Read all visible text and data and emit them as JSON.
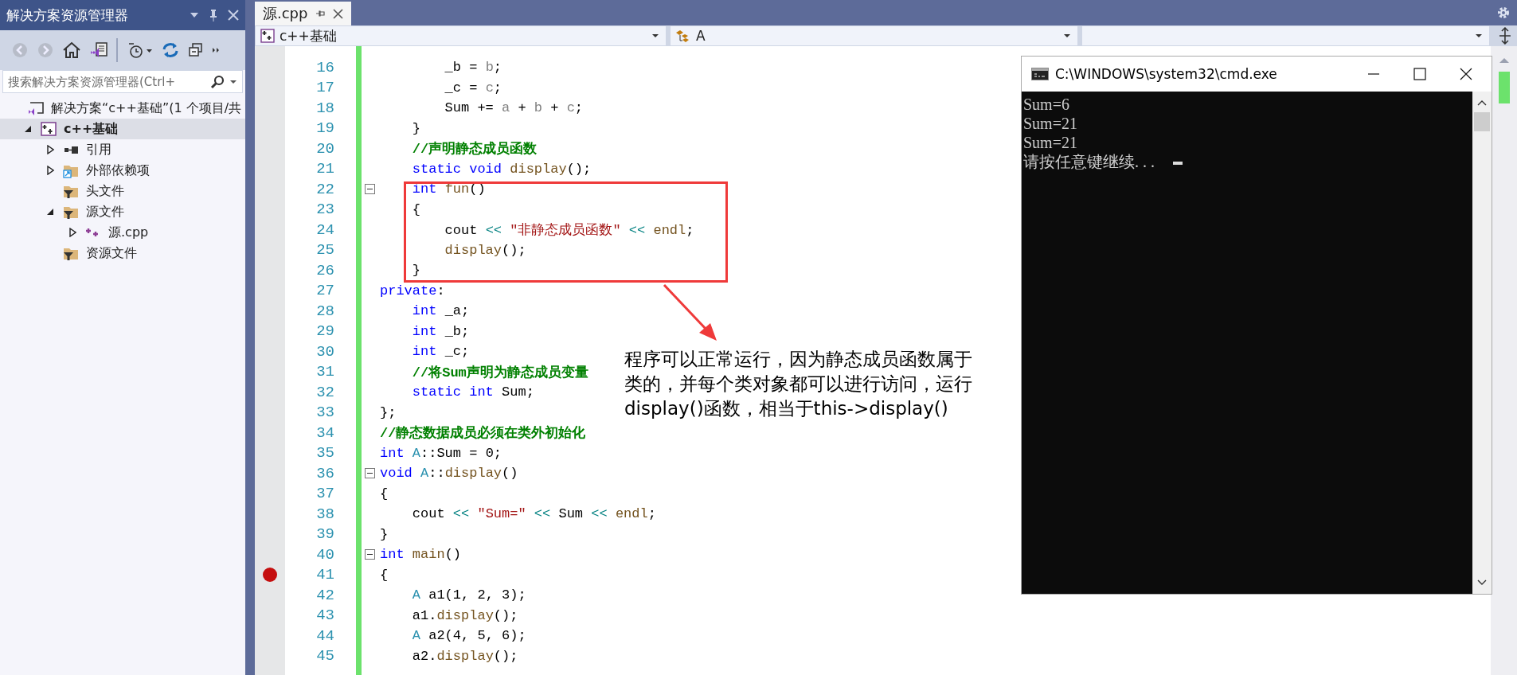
{
  "sidebar": {
    "title": "解决方案资源管理器",
    "search": {
      "placeholder": "搜索解决方案资源管理器(Ctrl+"
    },
    "tree": [
      {
        "label": "解决方案“c++基础”(1 个项目/共",
        "kind": "solution",
        "expandable": false,
        "selected": false,
        "bold": false,
        "children": [
          {
            "label": "c++基础",
            "kind": "project",
            "expandable": true,
            "expanded": true,
            "selected": true,
            "bold": true,
            "children": [
              {
                "label": "引用",
                "kind": "references",
                "expandable": true,
                "expanded": false,
                "selected": false,
                "bold": false
              },
              {
                "label": "外部依赖项",
                "kind": "external",
                "expandable": true,
                "expanded": false,
                "selected": false,
                "bold": false
              },
              {
                "label": "头文件",
                "kind": "filter",
                "expandable": false,
                "selected": false,
                "bold": false
              },
              {
                "label": "源文件",
                "kind": "filter",
                "expandable": true,
                "expanded": true,
                "selected": false,
                "bold": false,
                "children": [
                  {
                    "label": "源.cpp",
                    "kind": "cpp",
                    "expandable": true,
                    "expanded": false,
                    "selected": false,
                    "bold": false
                  }
                ]
              },
              {
                "label": "资源文件",
                "kind": "filter",
                "expandable": false,
                "selected": false,
                "bold": false
              }
            ]
          }
        ]
      }
    ]
  },
  "editor": {
    "tabs": [
      {
        "label": "源.cpp",
        "selected": true
      }
    ],
    "nav": {
      "project": "c++基础",
      "scope": "A"
    },
    "lines": [
      {
        "number": "16",
        "fold": false,
        "breakpoint": false,
        "tokens": [
          {
            "kind": "plain",
            "text": "        _b = "
          },
          {
            "kind": "param",
            "text": "b"
          },
          {
            "kind": "plain",
            "text": ";"
          }
        ]
      },
      {
        "number": "17",
        "fold": false,
        "breakpoint": false,
        "tokens": [
          {
            "kind": "plain",
            "text": "        _c = "
          },
          {
            "kind": "param",
            "text": "c"
          },
          {
            "kind": "plain",
            "text": ";"
          }
        ]
      },
      {
        "number": "18",
        "fold": false,
        "breakpoint": false,
        "tokens": [
          {
            "kind": "plain",
            "text": "        Sum += "
          },
          {
            "kind": "param",
            "text": "a"
          },
          {
            "kind": "plain",
            "text": " + "
          },
          {
            "kind": "param",
            "text": "b"
          },
          {
            "kind": "plain",
            "text": " + "
          },
          {
            "kind": "param",
            "text": "c"
          },
          {
            "kind": "plain",
            "text": ";"
          }
        ]
      },
      {
        "number": "19",
        "fold": false,
        "breakpoint": false,
        "tokens": [
          {
            "kind": "plain",
            "text": "    }"
          }
        ]
      },
      {
        "number": "20",
        "fold": false,
        "breakpoint": false,
        "tokens": [
          {
            "kind": "comment",
            "text": "    //声明静态成员函数"
          }
        ]
      },
      {
        "number": "21",
        "fold": false,
        "breakpoint": false,
        "tokens": [
          {
            "kind": "keyword",
            "text": "    static void "
          },
          {
            "kind": "function",
            "text": "display"
          },
          {
            "kind": "plain",
            "text": "();"
          }
        ]
      },
      {
        "number": "22",
        "fold": true,
        "breakpoint": false,
        "tokens": [
          {
            "kind": "keyword",
            "text": "    int "
          },
          {
            "kind": "function",
            "text": "fun"
          },
          {
            "kind": "plain",
            "text": "()"
          }
        ]
      },
      {
        "number": "23",
        "fold": false,
        "breakpoint": false,
        "tokens": [
          {
            "kind": "plain",
            "text": "    {"
          }
        ]
      },
      {
        "number": "24",
        "fold": false,
        "breakpoint": false,
        "tokens": [
          {
            "kind": "plain",
            "text": "        cout "
          },
          {
            "kind": "operator",
            "text": "<< "
          },
          {
            "kind": "string",
            "text": "\"非静态成员函数\""
          },
          {
            "kind": "operator",
            "text": " << "
          },
          {
            "kind": "function",
            "text": "endl"
          },
          {
            "kind": "plain",
            "text": ";"
          }
        ]
      },
      {
        "number": "25",
        "fold": false,
        "breakpoint": false,
        "tokens": [
          {
            "kind": "function",
            "text": "        display"
          },
          {
            "kind": "plain",
            "text": "();"
          }
        ]
      },
      {
        "number": "26",
        "fold": false,
        "breakpoint": false,
        "tokens": [
          {
            "kind": "plain",
            "text": "    }"
          }
        ]
      },
      {
        "number": "27",
        "fold": false,
        "breakpoint": false,
        "tokens": [
          {
            "kind": "keyword",
            "text": "private"
          },
          {
            "kind": "plain",
            "text": ":"
          }
        ]
      },
      {
        "number": "28",
        "fold": false,
        "breakpoint": false,
        "tokens": [
          {
            "kind": "keyword",
            "text": "    int "
          },
          {
            "kind": "plain",
            "text": "_a;"
          }
        ]
      },
      {
        "number": "29",
        "fold": false,
        "breakpoint": false,
        "tokens": [
          {
            "kind": "keyword",
            "text": "    int "
          },
          {
            "kind": "plain",
            "text": "_b;"
          }
        ]
      },
      {
        "number": "30",
        "fold": false,
        "breakpoint": false,
        "tokens": [
          {
            "kind": "keyword",
            "text": "    int "
          },
          {
            "kind": "plain",
            "text": "_c;"
          }
        ]
      },
      {
        "number": "31",
        "fold": false,
        "breakpoint": false,
        "tokens": [
          {
            "kind": "comment",
            "text": "    //将Sum声明为静态成员变量"
          }
        ]
      },
      {
        "number": "32",
        "fold": false,
        "breakpoint": false,
        "tokens": [
          {
            "kind": "keyword",
            "text": "    static int "
          },
          {
            "kind": "plain",
            "text": "Sum;"
          }
        ]
      },
      {
        "number": "33",
        "fold": false,
        "breakpoint": false,
        "tokens": [
          {
            "kind": "plain",
            "text": "};"
          }
        ]
      },
      {
        "number": "34",
        "fold": false,
        "breakpoint": false,
        "tokens": [
          {
            "kind": "comment",
            "text": "//静态数据成员必须在类外初始化"
          }
        ]
      },
      {
        "number": "35",
        "fold": false,
        "breakpoint": false,
        "tokens": [
          {
            "kind": "keyword",
            "text": "int "
          },
          {
            "kind": "type",
            "text": "A"
          },
          {
            "kind": "plain",
            "text": "::Sum = 0;"
          }
        ]
      },
      {
        "number": "36",
        "fold": true,
        "breakpoint": false,
        "tokens": [
          {
            "kind": "keyword",
            "text": "void "
          },
          {
            "kind": "type",
            "text": "A"
          },
          {
            "kind": "plain",
            "text": "::"
          },
          {
            "kind": "function",
            "text": "display"
          },
          {
            "kind": "plain",
            "text": "()"
          }
        ]
      },
      {
        "number": "37",
        "fold": false,
        "breakpoint": false,
        "tokens": [
          {
            "kind": "plain",
            "text": "{"
          }
        ]
      },
      {
        "number": "38",
        "fold": false,
        "breakpoint": false,
        "tokens": [
          {
            "kind": "plain",
            "text": "    cout "
          },
          {
            "kind": "operator",
            "text": "<< "
          },
          {
            "kind": "string",
            "text": "\"Sum=\""
          },
          {
            "kind": "operator",
            "text": " << "
          },
          {
            "kind": "plain",
            "text": "Sum "
          },
          {
            "kind": "operator",
            "text": "<< "
          },
          {
            "kind": "function",
            "text": "endl"
          },
          {
            "kind": "plain",
            "text": ";"
          }
        ]
      },
      {
        "number": "39",
        "fold": false,
        "breakpoint": false,
        "tokens": [
          {
            "kind": "plain",
            "text": "}"
          }
        ]
      },
      {
        "number": "40",
        "fold": true,
        "breakpoint": false,
        "tokens": [
          {
            "kind": "keyword",
            "text": "int "
          },
          {
            "kind": "function",
            "text": "main"
          },
          {
            "kind": "plain",
            "text": "()"
          }
        ]
      },
      {
        "number": "41",
        "fold": false,
        "breakpoint": true,
        "tokens": [
          {
            "kind": "plain",
            "text": "{"
          }
        ]
      },
      {
        "number": "42",
        "fold": false,
        "breakpoint": false,
        "tokens": [
          {
            "kind": "type",
            "text": "    A"
          },
          {
            "kind": "plain",
            "text": " a1(1, 2, 3);"
          }
        ]
      },
      {
        "number": "43",
        "fold": false,
        "breakpoint": false,
        "tokens": [
          {
            "kind": "plain",
            "text": "    a1."
          },
          {
            "kind": "function",
            "text": "display"
          },
          {
            "kind": "plain",
            "text": "();"
          }
        ]
      },
      {
        "number": "44",
        "fold": false,
        "breakpoint": false,
        "tokens": [
          {
            "kind": "type",
            "text": "    A"
          },
          {
            "kind": "plain",
            "text": " a2(4, 5, 6);"
          }
        ]
      },
      {
        "number": "45",
        "fold": false,
        "breakpoint": false,
        "tokens": [
          {
            "kind": "plain",
            "text": "    a2."
          },
          {
            "kind": "function",
            "text": "display"
          },
          {
            "kind": "plain",
            "text": "();"
          }
        ]
      }
    ]
  },
  "annotation": {
    "text": "程序可以正常运行，因为静态成员函数属于类的，并每个类对象都可以进行访问，运行display()函数，相当于this->display()"
  },
  "console": {
    "title": "C:\\WINDOWS\\system32\\cmd.exe",
    "lines": [
      "Sum=6",
      "Sum=21",
      "Sum=21",
      "请按任意键继续. . ."
    ]
  }
}
